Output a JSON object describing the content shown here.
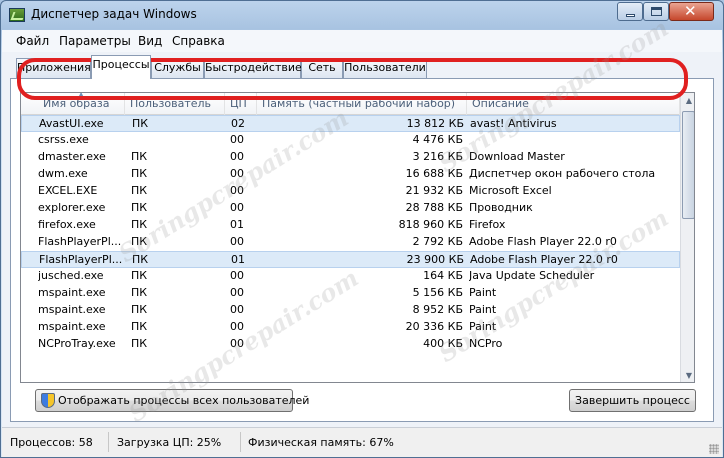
{
  "window": {
    "title": "Диспетчер задач Windows"
  },
  "menu": [
    "Файл",
    "Параметры",
    "Вид",
    "Справка"
  ],
  "tabs": [
    {
      "label": "Приложения",
      "active": false
    },
    {
      "label": "Процессы",
      "active": true
    },
    {
      "label": "Службы",
      "active": false
    },
    {
      "label": "Быстродействие",
      "active": false
    },
    {
      "label": "Сеть",
      "active": false
    },
    {
      "label": "Пользователи",
      "active": false
    }
  ],
  "columns": [
    "Имя образа",
    "Пользователь",
    "ЦП",
    "Память (частный рабочий набор)",
    "Описание"
  ],
  "processes": [
    {
      "name": "AvastUI.exe",
      "user": "ПК",
      "cpu": "02",
      "mem": "13 812 КБ",
      "desc": "avast! Antivirus",
      "selected": true
    },
    {
      "name": "csrss.exe",
      "user": "",
      "cpu": "00",
      "mem": "4 476 КБ",
      "desc": ""
    },
    {
      "name": "dmaster.exe",
      "user": "ПК",
      "cpu": "00",
      "mem": "3 216 КБ",
      "desc": "Download Master"
    },
    {
      "name": "dwm.exe",
      "user": "ПК",
      "cpu": "00",
      "mem": "16 688 КБ",
      "desc": "Диспетчер окон рабочего стола"
    },
    {
      "name": "EXCEL.EXE",
      "user": "ПК",
      "cpu": "00",
      "mem": "21 932 КБ",
      "desc": "Microsoft Excel"
    },
    {
      "name": "explorer.exe",
      "user": "ПК",
      "cpu": "00",
      "mem": "28 788 КБ",
      "desc": "Проводник"
    },
    {
      "name": "firefox.exe",
      "user": "ПК",
      "cpu": "01",
      "mem": "818 960 КБ",
      "desc": "Firefox"
    },
    {
      "name": "FlashPlayerPl...",
      "user": "ПК",
      "cpu": "00",
      "mem": "2 792 КБ",
      "desc": "Adobe Flash Player 22.0 r0"
    },
    {
      "name": "FlashPlayerPl...",
      "user": "ПК",
      "cpu": "01",
      "mem": "23 900 КБ",
      "desc": "Adobe Flash Player 22.0 r0",
      "selected": true
    },
    {
      "name": "jusched.exe",
      "user": "ПК",
      "cpu": "00",
      "mem": "164 КБ",
      "desc": "Java Update Scheduler"
    },
    {
      "name": "mspaint.exe",
      "user": "ПК",
      "cpu": "00",
      "mem": "5 156 КБ",
      "desc": "Paint"
    },
    {
      "name": "mspaint.exe",
      "user": "ПК",
      "cpu": "00",
      "mem": "8 952 КБ",
      "desc": "Paint"
    },
    {
      "name": "mspaint.exe",
      "user": "ПК",
      "cpu": "00",
      "mem": "20 336 КБ",
      "desc": "Paint"
    },
    {
      "name": "NCProTray.exe",
      "user": "ПК",
      "cpu": "00",
      "mem": "400 КБ",
      "desc": "NCPro"
    }
  ],
  "buttons": {
    "show_all": "Отображать процессы всех пользователей",
    "end_process": "Завершить процесс"
  },
  "status": {
    "processes": "Процессов: 58",
    "cpu": "Загрузка ЦП: 25%",
    "memory": "Физическая память: 67%"
  },
  "watermark": "Soringpcrepair.com"
}
